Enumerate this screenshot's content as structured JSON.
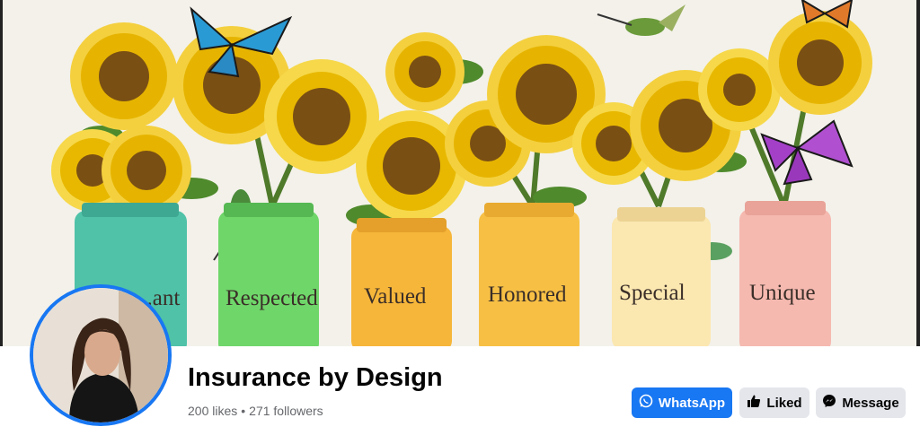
{
  "cover": {
    "jar_labels": [
      "...ant",
      "Respected",
      "Valued",
      "Honored",
      "Special",
      "Unique"
    ]
  },
  "page": {
    "name": "Insurance by Design",
    "likes": "200 likes",
    "separator": "•",
    "followers": "271 followers"
  },
  "actions": {
    "whatsapp_label": "WhatsApp",
    "liked_label": "Liked",
    "message_label": "Message"
  },
  "icons": {
    "whatsapp": "whatsapp-icon",
    "liked": "thumbs-up-icon",
    "message": "messenger-icon"
  },
  "colors": {
    "accent": "#1877f2",
    "secondary_button": "#e4e6eb",
    "title_text": "#050505",
    "muted_text": "#65676b"
  }
}
